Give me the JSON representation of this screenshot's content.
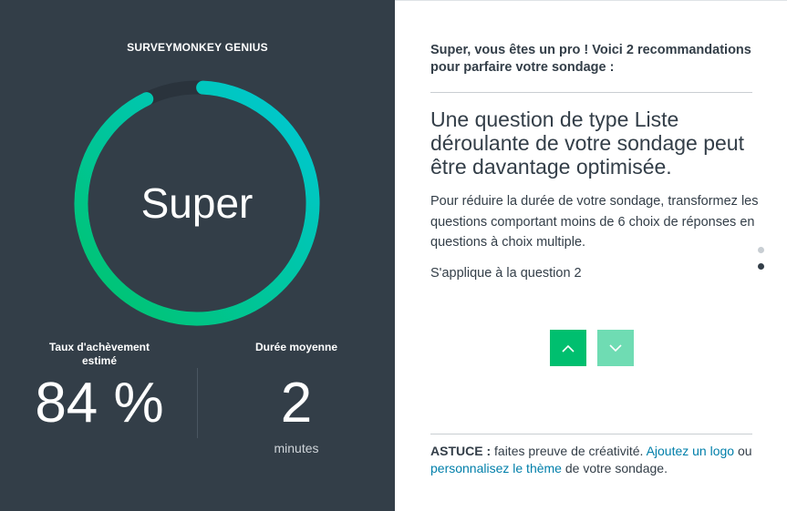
{
  "genius": {
    "title": "SURVEYMONKEY GENIUS",
    "rating": "Super",
    "completion_fraction": 0.92,
    "gradient_start": "#00c36a",
    "gradient_end": "#00c8d7",
    "track_color": "#2a333c"
  },
  "metrics": {
    "completion": {
      "label": "Taux d'achèvement estimé",
      "value": "84 %"
    },
    "duration": {
      "label": "Durée moyenne",
      "value": "2",
      "unit": "minutes"
    }
  },
  "recommendation": {
    "headline": "Super, vous êtes un pro ! Voici 2 recommandations pour parfaire votre sondage :",
    "title": "Une question de type Liste déroulante de votre sondage peut être davantage optimisée.",
    "body": "Pour réduire la durée de votre sondage, transformez les questions comportant moins de 6 choix de réponses en questions à choix multiple.",
    "applies_to": "S'applique à la question 2",
    "current_index": 2,
    "total": 2
  },
  "nav": {
    "up_icon": "chevron-up-icon",
    "down_icon": "chevron-down-icon"
  },
  "tip": {
    "prefix": "ASTUCE :",
    "text1": " faites preuve de créativité. ",
    "link1": "Ajoutez un logo",
    "text2": " ou ",
    "link2": "personnalisez le thème",
    "text3": " de votre sondage."
  }
}
